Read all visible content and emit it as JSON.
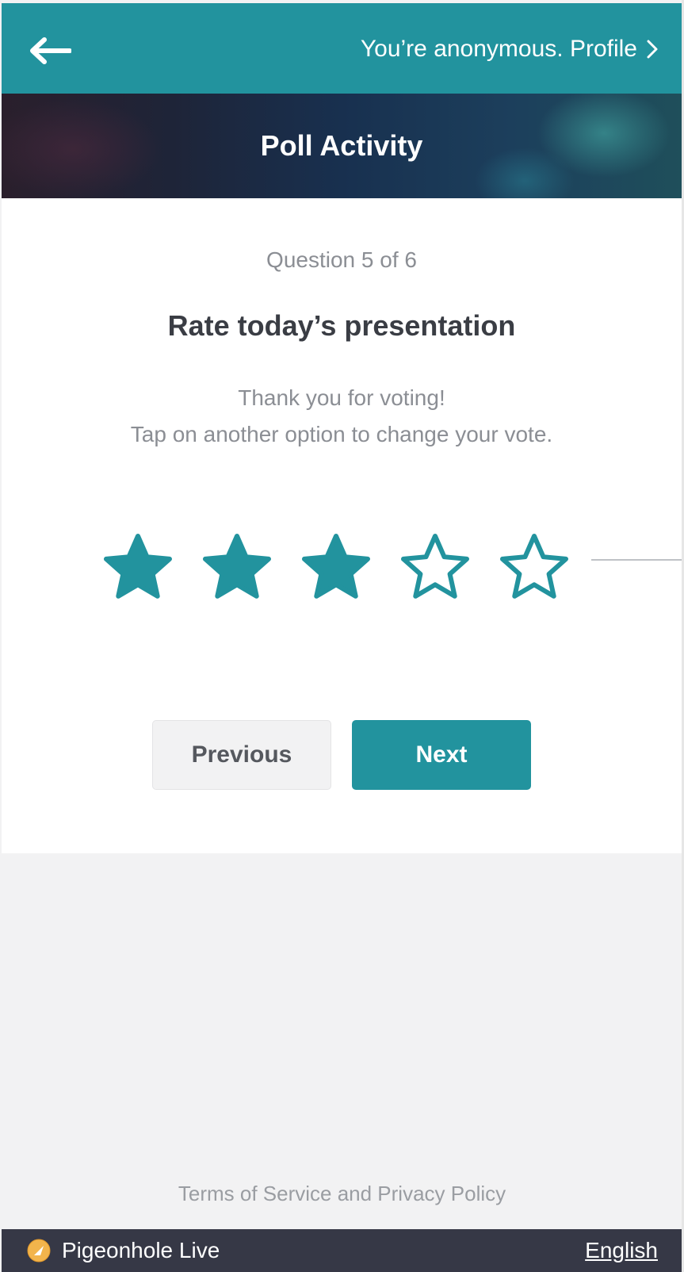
{
  "header": {
    "profile_text": "You’re anonymous. Profile",
    "back_icon": "back-arrow-icon",
    "chevron_icon": "chevron-right-icon"
  },
  "banner": {
    "title": "Poll Activity"
  },
  "question": {
    "progress": "Question 5 of 6",
    "title": "Rate today’s presentation",
    "message_line1": "Thank you for voting!",
    "message_line2": "Tap on another option to change your vote."
  },
  "rating": {
    "value": 3,
    "max": 5
  },
  "buttons": {
    "previous": "Previous",
    "next": "Next"
  },
  "links": {
    "terms": "Terms of Service and Privacy Policy"
  },
  "footer": {
    "brand": "Pigeonhole Live",
    "language": "English"
  },
  "colors": {
    "accent": "#22939e",
    "footer_bg": "#363846",
    "page_bg": "#f2f2f3"
  }
}
